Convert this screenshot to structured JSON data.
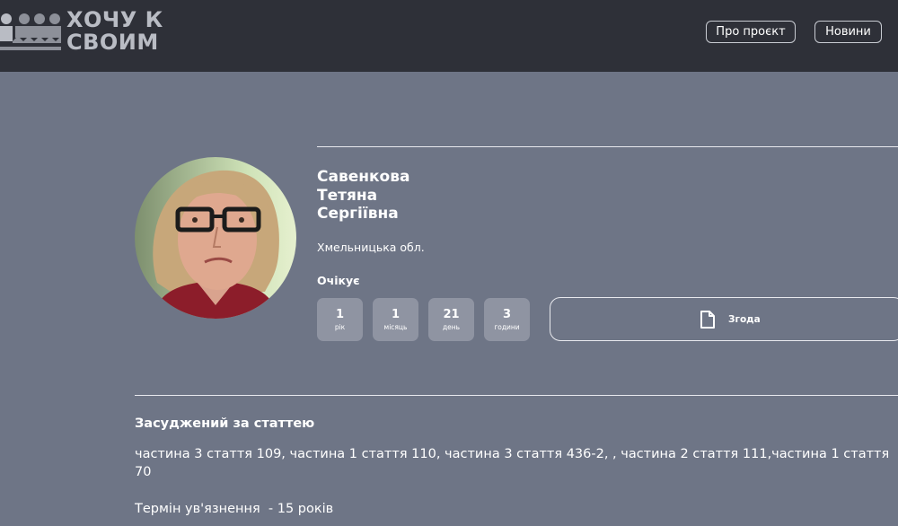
{
  "header": {
    "logo": {
      "line1": "ХОЧУ К",
      "line2": "СВОИМ"
    },
    "nav": {
      "about_label": "Про проєкт",
      "news_label": "Новини"
    }
  },
  "profile": {
    "surname": "Савенкова",
    "first_name": "Тетяна",
    "patronymic": "Сергіївна",
    "region": "Хмельницька обл.",
    "status": "Очікує",
    "counters": [
      {
        "value": "1",
        "unit": "рік"
      },
      {
        "value": "1",
        "unit": "місяць"
      },
      {
        "value": "21",
        "unit": "день"
      },
      {
        "value": "3",
        "unit": "години"
      }
    ],
    "consent_label": "Згода"
  },
  "details": {
    "section_title": "Засуджений за статтею",
    "articles": "частина 3 стаття 109, частина 1 стаття 110, частина 3 стаття 436-2, , частина 2 стаття 111,частина 1 стаття 70",
    "term": "Термін ув'язнення  - 15 років"
  },
  "colors": {
    "header_bg": "#2e3038",
    "page_bg": "#6e7586",
    "counter_bg": "#8f94a2"
  }
}
